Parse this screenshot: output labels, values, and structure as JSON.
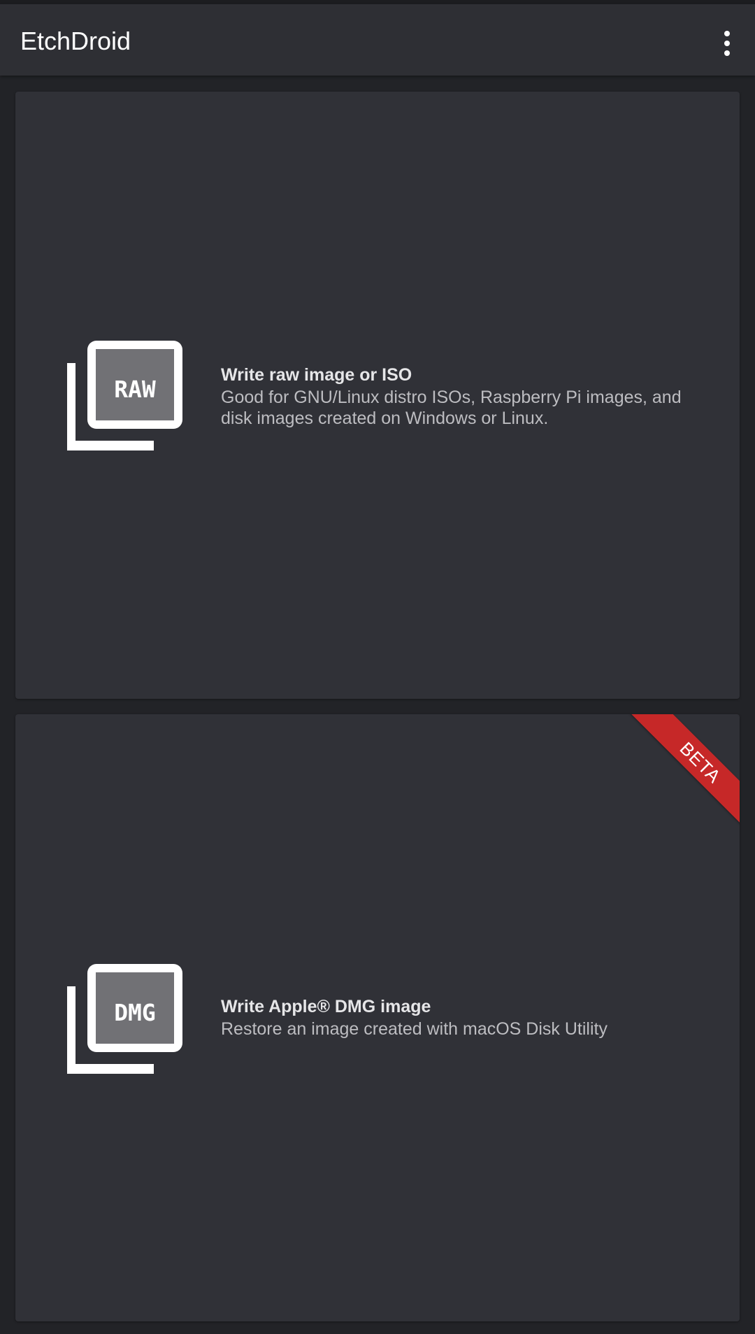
{
  "app": {
    "title": "EtchDroid",
    "menu_icon": "more-vert-icon"
  },
  "colors": {
    "background": "#222327",
    "app_bar": "#2e2f34",
    "card": "#303137",
    "beta_ribbon": "#c62828"
  },
  "cards": [
    {
      "icon": "raw-image-icon",
      "icon_label": "RAW",
      "title": "Write raw image or ISO",
      "description": "Good for GNU/Linux distro ISOs, Raspberry Pi images, and disk images created on Windows or Linux."
    },
    {
      "icon": "dmg-image-icon",
      "icon_label": "DMG",
      "title": "Write Apple® DMG image",
      "description": "Restore an image created with macOS Disk Utility",
      "badge": "BETA"
    }
  ]
}
